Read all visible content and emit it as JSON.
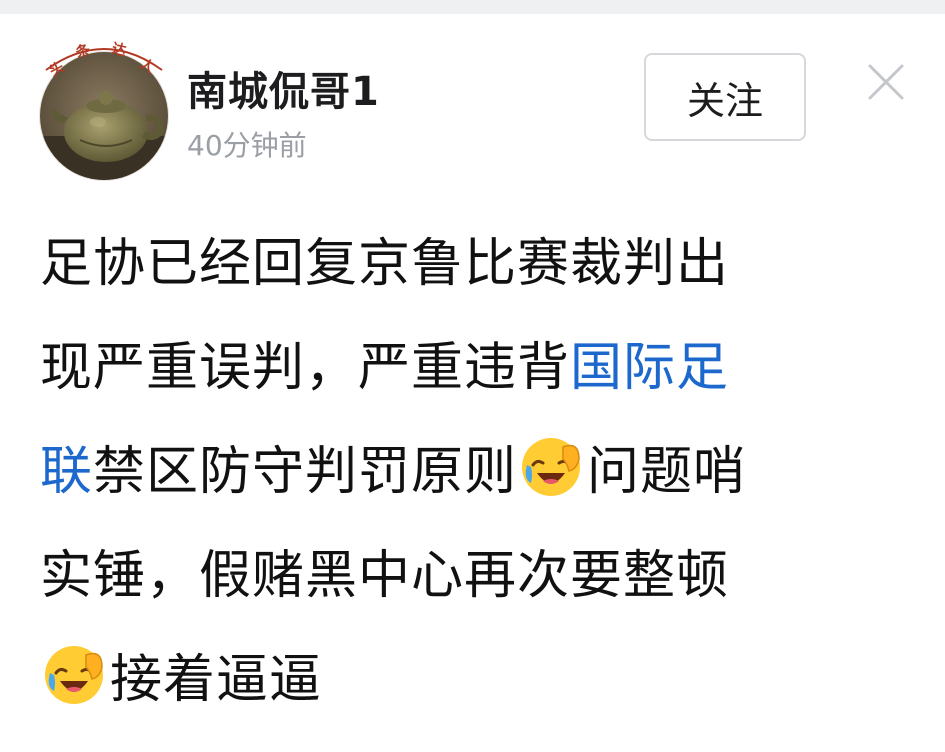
{
  "author": {
    "name": "南城侃哥1",
    "time": "40分钟前",
    "badge_chars": [
      "头",
      "条",
      "达",
      "人"
    ]
  },
  "actions": {
    "follow_label": "关注",
    "close_icon": "close-icon"
  },
  "post": {
    "line1": "足协已经回复京鲁比赛裁判出",
    "line2_text": "现严重误判，严重违背",
    "line2_link": "国际足",
    "line3_link": "联",
    "line3_text_a": "禁区防守判罚原则",
    "line3_text_b": "问题哨",
    "line4": "实锤，假赌黑中心再次要整顿",
    "line5": "接着逼逼",
    "emoji": "laughing-crying-face-emoji"
  },
  "colors": {
    "link": "#1c68cc",
    "text": "#111111",
    "muted": "#9a9ea5"
  }
}
